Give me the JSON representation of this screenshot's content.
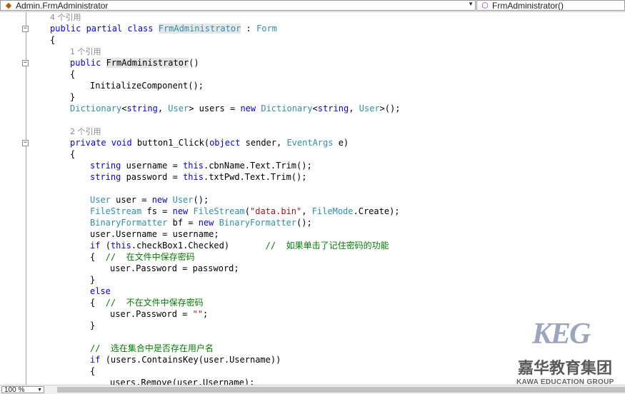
{
  "navbar": {
    "class_combo": {
      "icon": "class-icon",
      "value": "Admin.FrmAdministrator"
    },
    "member_combo": {
      "icon": "method-icon",
      "value": "FrmAdministrator()"
    }
  },
  "editor": {
    "lines": [
      {
        "indent": 0,
        "fold": false,
        "tokens": [
          {
            "c": "lens",
            "t": "4 个引用"
          }
        ]
      },
      {
        "indent": 0,
        "fold": true,
        "tokens": [
          {
            "c": "kw",
            "t": "public partial class "
          },
          {
            "c": "ty hl",
            "t": "FrmAdministrator"
          },
          {
            "c": "",
            "t": " : "
          },
          {
            "c": "ty",
            "t": "Form"
          }
        ]
      },
      {
        "indent": 0,
        "fold": false,
        "tokens": [
          {
            "c": "",
            "t": "{"
          }
        ]
      },
      {
        "indent": 1,
        "fold": false,
        "tokens": [
          {
            "c": "lens",
            "t": "1 个引用"
          }
        ]
      },
      {
        "indent": 1,
        "fold": true,
        "tokens": [
          {
            "c": "kw",
            "t": "public "
          },
          {
            "c": "hl",
            "t": "FrmAdministrator"
          },
          {
            "c": "",
            "t": "()"
          }
        ]
      },
      {
        "indent": 1,
        "fold": false,
        "tokens": [
          {
            "c": "",
            "t": "{"
          }
        ]
      },
      {
        "indent": 2,
        "fold": false,
        "tokens": [
          {
            "c": "",
            "t": "InitializeComponent();"
          }
        ]
      },
      {
        "indent": 1,
        "fold": false,
        "tokens": [
          {
            "c": "",
            "t": "}"
          }
        ]
      },
      {
        "indent": 1,
        "fold": false,
        "tokens": [
          {
            "c": "ty",
            "t": "Dictionary"
          },
          {
            "c": "",
            "t": "<"
          },
          {
            "c": "kw",
            "t": "string"
          },
          {
            "c": "",
            "t": ", "
          },
          {
            "c": "ty",
            "t": "User"
          },
          {
            "c": "",
            "t": "> users = "
          },
          {
            "c": "kw",
            "t": "new "
          },
          {
            "c": "ty",
            "t": "Dictionary"
          },
          {
            "c": "",
            "t": "<"
          },
          {
            "c": "kw",
            "t": "string"
          },
          {
            "c": "",
            "t": ", "
          },
          {
            "c": "ty",
            "t": "User"
          },
          {
            "c": "",
            "t": ">();"
          }
        ]
      },
      {
        "indent": 0,
        "fold": false,
        "tokens": []
      },
      {
        "indent": 1,
        "fold": false,
        "tokens": [
          {
            "c": "lens",
            "t": "2 个引用"
          }
        ]
      },
      {
        "indent": 1,
        "fold": true,
        "tokens": [
          {
            "c": "kw",
            "t": "private void "
          },
          {
            "c": "",
            "t": "button1_Click("
          },
          {
            "c": "kw",
            "t": "object "
          },
          {
            "c": "",
            "t": "sender, "
          },
          {
            "c": "ty",
            "t": "EventArgs "
          },
          {
            "c": "",
            "t": "e)"
          }
        ]
      },
      {
        "indent": 1,
        "fold": false,
        "tokens": [
          {
            "c": "",
            "t": "{"
          }
        ]
      },
      {
        "indent": 2,
        "fold": false,
        "tokens": [
          {
            "c": "kw",
            "t": "string "
          },
          {
            "c": "",
            "t": "username = "
          },
          {
            "c": "kw",
            "t": "this"
          },
          {
            "c": "",
            "t": ".cbnName.Text.Trim();"
          }
        ]
      },
      {
        "indent": 2,
        "fold": false,
        "tokens": [
          {
            "c": "kw",
            "t": "string "
          },
          {
            "c": "",
            "t": "password = "
          },
          {
            "c": "kw",
            "t": "this"
          },
          {
            "c": "",
            "t": ".txtPwd.Text.Trim();"
          }
        ]
      },
      {
        "indent": 0,
        "fold": false,
        "tokens": []
      },
      {
        "indent": 2,
        "fold": false,
        "tokens": [
          {
            "c": "ty",
            "t": "User "
          },
          {
            "c": "",
            "t": "user = "
          },
          {
            "c": "kw",
            "t": "new "
          },
          {
            "c": "ty",
            "t": "User"
          },
          {
            "c": "",
            "t": "();"
          }
        ]
      },
      {
        "indent": 2,
        "fold": false,
        "tokens": [
          {
            "c": "ty",
            "t": "FileStream "
          },
          {
            "c": "",
            "t": "fs = "
          },
          {
            "c": "kw",
            "t": "new "
          },
          {
            "c": "ty",
            "t": "FileStream"
          },
          {
            "c": "",
            "t": "("
          },
          {
            "c": "str",
            "t": "\"data.bin\""
          },
          {
            "c": "",
            "t": ", "
          },
          {
            "c": "ty",
            "t": "FileMode"
          },
          {
            "c": "",
            "t": ".Create);"
          }
        ]
      },
      {
        "indent": 2,
        "fold": false,
        "tokens": [
          {
            "c": "ty",
            "t": "BinaryFormatter "
          },
          {
            "c": "",
            "t": "bf = "
          },
          {
            "c": "kw",
            "t": "new "
          },
          {
            "c": "ty",
            "t": "BinaryFormatter"
          },
          {
            "c": "",
            "t": "();"
          }
        ]
      },
      {
        "indent": 2,
        "fold": false,
        "tokens": [
          {
            "c": "",
            "t": "user.Username = username;"
          }
        ]
      },
      {
        "indent": 2,
        "fold": false,
        "tokens": [
          {
            "c": "kw",
            "t": "if "
          },
          {
            "c": "",
            "t": "("
          },
          {
            "c": "kw",
            "t": "this"
          },
          {
            "c": "",
            "t": ".checkBox1.Checked)       "
          },
          {
            "c": "cm",
            "t": "//  如果单击了记住密码的功能"
          }
        ]
      },
      {
        "indent": 2,
        "fold": false,
        "tokens": [
          {
            "c": "",
            "t": "{  "
          },
          {
            "c": "cm",
            "t": "//  在文件中保存密码"
          }
        ]
      },
      {
        "indent": 3,
        "fold": false,
        "tokens": [
          {
            "c": "",
            "t": "user.Password = password;"
          }
        ]
      },
      {
        "indent": 2,
        "fold": false,
        "tokens": [
          {
            "c": "",
            "t": "}"
          }
        ]
      },
      {
        "indent": 2,
        "fold": false,
        "tokens": [
          {
            "c": "kw",
            "t": "else"
          }
        ]
      },
      {
        "indent": 2,
        "fold": false,
        "tokens": [
          {
            "c": "",
            "t": "{  "
          },
          {
            "c": "cm",
            "t": "//  不在文件中保存密码"
          }
        ]
      },
      {
        "indent": 3,
        "fold": false,
        "tokens": [
          {
            "c": "",
            "t": "user.Password = "
          },
          {
            "c": "str",
            "t": "\"\""
          },
          {
            "c": "",
            "t": ";"
          }
        ]
      },
      {
        "indent": 2,
        "fold": false,
        "tokens": [
          {
            "c": "",
            "t": "}"
          }
        ]
      },
      {
        "indent": 0,
        "fold": false,
        "tokens": []
      },
      {
        "indent": 2,
        "fold": false,
        "tokens": [
          {
            "c": "cm",
            "t": "//  选在集合中是否存在用户名"
          }
        ]
      },
      {
        "indent": 2,
        "fold": false,
        "tokens": [
          {
            "c": "kw",
            "t": "if "
          },
          {
            "c": "",
            "t": "(users.ContainsKey(user.Username))"
          }
        ]
      },
      {
        "indent": 2,
        "fold": false,
        "tokens": [
          {
            "c": "",
            "t": "{"
          }
        ]
      },
      {
        "indent": 3,
        "fold": false,
        "tokens": [
          {
            "c": "",
            "t": "users.Remove(user.Username);"
          }
        ]
      }
    ]
  },
  "statusbar": {
    "zoom": "100 %"
  },
  "watermark": {
    "logo": "KEG",
    "cn": "嘉华教育集团",
    "en": "KAWA EDUCATION GROUP"
  }
}
